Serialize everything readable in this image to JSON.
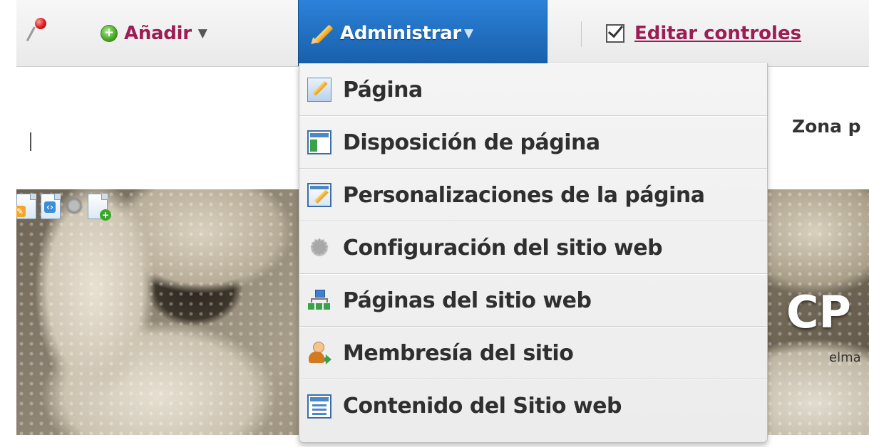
{
  "dockbar": {
    "add_label": "Añadir",
    "add_caret": "▼",
    "admin_label": "Administrar",
    "admin_caret": "▼",
    "edit_controls_label": "Editar controles"
  },
  "header": {
    "zone_text": "Zona p"
  },
  "banner": {
    "logo_text": "CP",
    "sub_text": "elma"
  },
  "admin_menu": {
    "items": [
      {
        "label": "Página",
        "icon": "page-edit-icon"
      },
      {
        "label": "Disposición de página",
        "icon": "page-layout-icon"
      },
      {
        "label": "Personalizaciones de la página",
        "icon": "page-customization-icon"
      },
      {
        "label": "Configuración del sitio web",
        "icon": "gear-icon"
      },
      {
        "label": "Páginas del sitio web",
        "icon": "sitemap-icon"
      },
      {
        "label": "Membresía del sitio",
        "icon": "membership-icon"
      },
      {
        "label": "Contenido del Sitio web",
        "icon": "site-content-icon"
      }
    ]
  },
  "colors": {
    "accent": "#9c1d54",
    "admin_active_bg": "#2171c4",
    "menu_bg": "#efefef",
    "menu_text": "#2f2f2f"
  }
}
